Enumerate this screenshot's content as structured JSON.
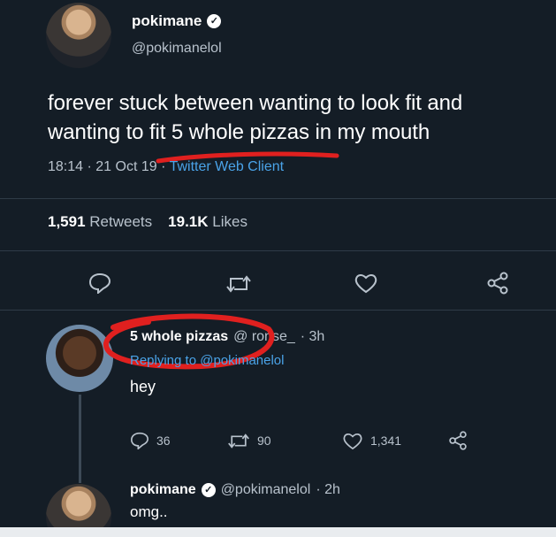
{
  "tweet": {
    "author_name": "pokimane",
    "author_handle": "@pokimanelol",
    "text_line1": "forever stuck between wanting to look fit and",
    "text_line2": "wanting to fit 5 whole pizzas in my mouth",
    "time": "18:14 · 21 Oct 19 ·",
    "client": "Twitter Web Client",
    "retweets_count": "1,591",
    "retweets_label": "Retweets",
    "likes_count": "19.1K",
    "likes_label": "Likes"
  },
  "reply": {
    "author_name": "5 whole pizzas",
    "author_handle": "@ ronse_",
    "age": "· 3h",
    "replying_to": "Replying to @pokimanelol",
    "text": "hey",
    "replies": "36",
    "retweets": "90",
    "likes": "1,341"
  },
  "reply2": {
    "author_name": "pokimane",
    "author_handle": "@pokimanelol",
    "age": "· 2h",
    "text": "omg.."
  },
  "icons": [
    "reply-icon",
    "retweet-icon",
    "like-icon",
    "share-icon",
    "verified-icon"
  ],
  "colors": {
    "background": "#141d26",
    "link": "#4aa3e8",
    "annotation_red": "#e0201f",
    "muted": "#b8c2cc"
  }
}
